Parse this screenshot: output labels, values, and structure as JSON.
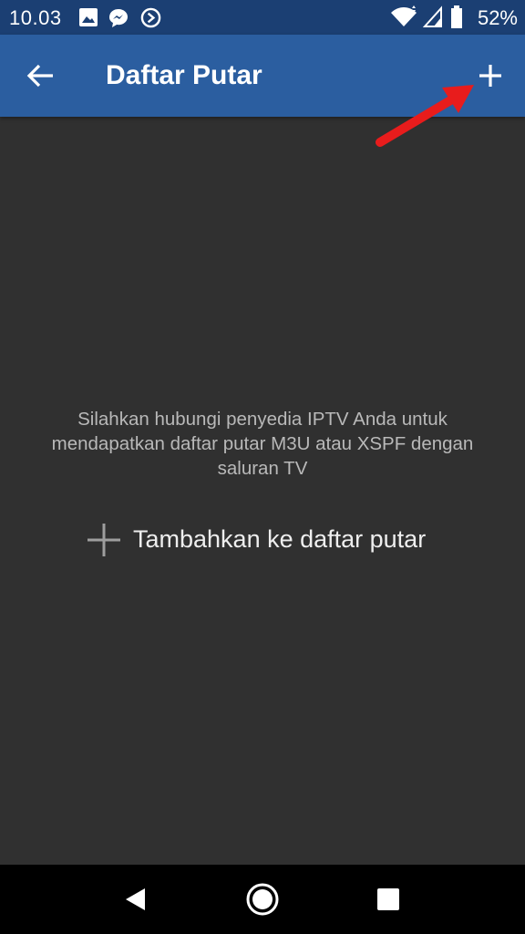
{
  "status_bar": {
    "time": "10.03",
    "battery_percent": "52%",
    "icons": [
      "image-icon",
      "messenger-icon",
      "play-circle-icon",
      "wifi-icon",
      "signal-icon",
      "battery-icon"
    ]
  },
  "app_bar": {
    "title": "Daftar Putar",
    "back_icon": "arrow-left-icon",
    "add_icon": "plus-icon",
    "background_color": "#2b5ea0"
  },
  "annotation": {
    "arrow_color": "#e81c1c"
  },
  "empty_state": {
    "message": "Silahkan hubungi penyedia IPTV Anda untuk mendapatkan daftar putar M3U atau XSPF dengan saluran TV",
    "add_label": "Tambahkan ke daftar putar",
    "add_icon": "plus-icon"
  },
  "nav_bar": {
    "buttons": [
      "back-triangle-icon",
      "home-circle-icon",
      "recents-square-icon"
    ]
  },
  "colors": {
    "status_bar": "#1b3f73",
    "background": "#303030",
    "message_text": "#b9b9b9"
  }
}
